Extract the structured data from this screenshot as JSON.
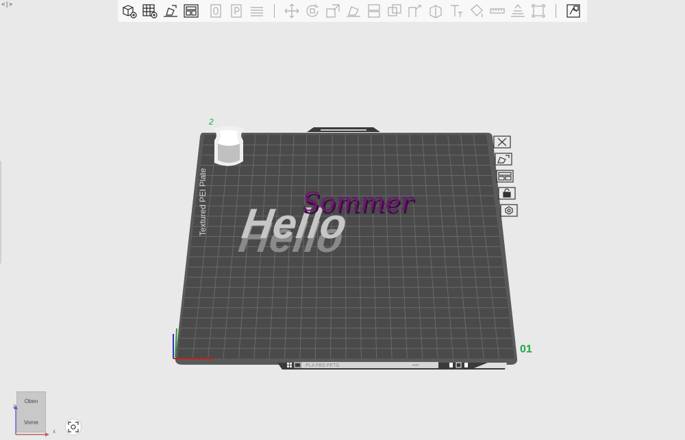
{
  "app": {
    "sidebar_toggle": "<|>"
  },
  "toolbar": {
    "groups": [
      [
        {
          "name": "add-object",
          "icon": "cube-plus-icon",
          "enabled": true
        },
        {
          "name": "add-plate",
          "icon": "grid-plus-icon",
          "enabled": true
        },
        {
          "name": "auto-orient",
          "icon": "auto-orient-icon",
          "enabled": true
        },
        {
          "name": "arrange",
          "icon": "arrange-icon",
          "enabled": true
        },
        {
          "name": "split-objects",
          "icon": "split-objects-icon",
          "enabled": false
        },
        {
          "name": "split-parts",
          "icon": "split-parts-icon",
          "enabled": false
        },
        {
          "name": "layers",
          "icon": "layers-icon",
          "enabled": false
        }
      ],
      [
        {
          "name": "move",
          "icon": "move-icon",
          "enabled": false
        },
        {
          "name": "rotate",
          "icon": "rotate-icon",
          "enabled": false
        },
        {
          "name": "scale",
          "icon": "scale-icon",
          "enabled": false
        },
        {
          "name": "lay-on-face",
          "icon": "lay-on-face-icon",
          "enabled": false
        },
        {
          "name": "cut",
          "icon": "cut-icon",
          "enabled": false
        },
        {
          "name": "boolean",
          "icon": "boolean-icon",
          "enabled": false
        },
        {
          "name": "support-paint",
          "icon": "support-paint-icon",
          "enabled": false
        },
        {
          "name": "seam-paint",
          "icon": "seam-paint-icon",
          "enabled": false
        },
        {
          "name": "text-shape",
          "icon": "text-shape-icon",
          "enabled": false
        },
        {
          "name": "color-paint",
          "icon": "color-paint-icon",
          "enabled": false
        },
        {
          "name": "measure",
          "icon": "measure-icon",
          "enabled": false
        },
        {
          "name": "assembly",
          "icon": "assembly-icon",
          "enabled": false
        },
        {
          "name": "variable-layer",
          "icon": "variable-layer-icon",
          "enabled": false
        }
      ],
      [
        {
          "name": "assembly-view",
          "icon": "assembly-view-icon",
          "enabled": true
        }
      ]
    ]
  },
  "plate": {
    "number": "01",
    "bed_text": "Textured PEI Plate",
    "filament_label": "PLA PBS PETG",
    "status_label": "auto",
    "model_text_1": "Hello",
    "model_text_2": "Sommer",
    "object_badge": "2",
    "colors": {
      "bed": "#4a4a4a",
      "grid": "#6a6a6a",
      "hello_face": "#bdbdbd",
      "hello_side": "#8a8a8a",
      "sommer": "#6a1a6e",
      "plate_number": "#1faa3a"
    },
    "side_buttons": [
      {
        "name": "close-plate-button",
        "icon": "close-icon"
      },
      {
        "name": "orient-plate-button",
        "icon": "orient-icon"
      },
      {
        "name": "arrange-plate-button",
        "icon": "arrange-icon"
      },
      {
        "name": "lock-plate-button",
        "icon": "lock-icon"
      },
      {
        "name": "plate-settings-button",
        "icon": "gear-icon"
      }
    ]
  },
  "nav_cube": {
    "top": "Oben",
    "front": "Vorne"
  },
  "axes": {
    "x": "X",
    "z": "Z"
  }
}
